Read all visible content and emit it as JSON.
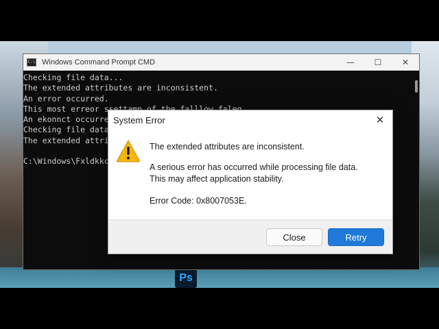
{
  "cmd_window": {
    "title": "Windows Command Prompt CMD",
    "icon_label": "C:\\",
    "controls": {
      "minimize": "—",
      "maximize": "☐",
      "close": "✕"
    },
    "lines": [
      "Checking file data...",
      "The extended attributes are inconsistent.",
      "An error occurred.",
      "This most erreor ssettamp of the falllow faleq.",
      "An ekonnct occurre",
      "Checking file data",
      "The extended attrib",
      "",
      "C:\\Windows\\Fxldkkc5"
    ]
  },
  "dialog": {
    "title": "System Error",
    "close_glyph": "✕",
    "main_message": "The extended attributes are inconsistent.",
    "detail_line_1": "A serious error has occurred while processing file data.",
    "detail_line_2": "This may affect application stability.",
    "error_code": "Error Code: 0x8007053E.",
    "close_button": "Close",
    "retry_button": "Retry",
    "icon": "warning-icon",
    "accent_color": "#1f7ad9"
  },
  "taskbar": {
    "photoshop_label": "Ps"
  }
}
